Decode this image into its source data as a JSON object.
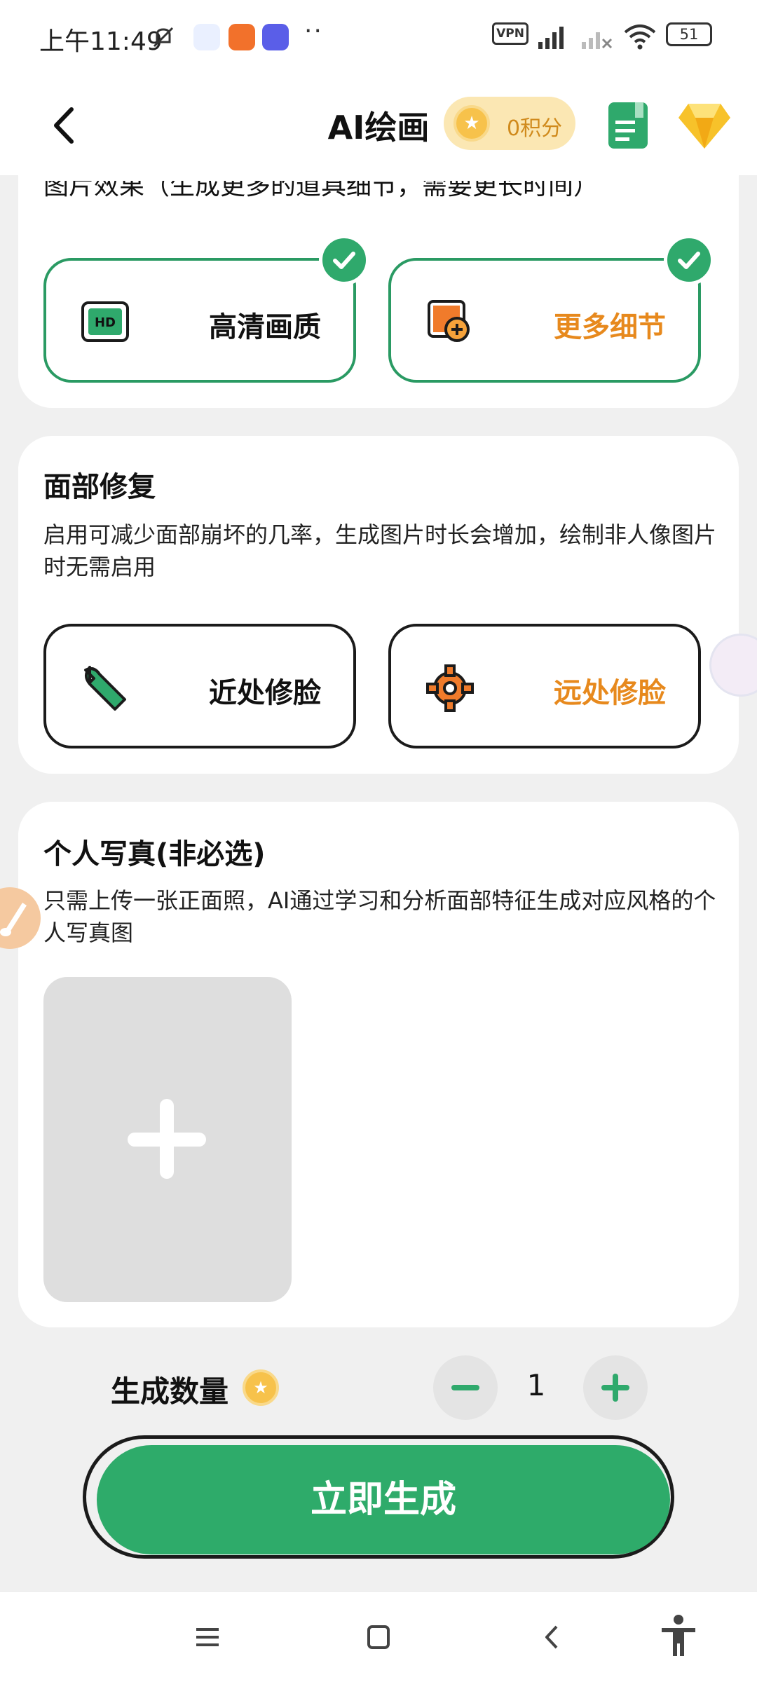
{
  "status_bar": {
    "time": "上午11:49",
    "vpn": "VPN",
    "battery": "51"
  },
  "header": {
    "title": "AI绘画",
    "points": "0积分"
  },
  "image_effect": {
    "title": "图片效果（生成更多的道具细节，需要更长时间）",
    "options": [
      {
        "label": "高清画质",
        "selected": true
      },
      {
        "label": "更多细节",
        "selected": true
      }
    ]
  },
  "face_repair": {
    "title": "面部修复",
    "description": "启用可减少面部崩坏的几率，生成图片时长会增加，绘制非人像图片时无需启用",
    "options": [
      {
        "label": "近处修脸"
      },
      {
        "label": "远处修脸"
      }
    ]
  },
  "portrait": {
    "title": "个人写真(非必选)",
    "description": "只需上传一张正面照，AI通过学习和分析面部特征生成对应风格的个人写真图"
  },
  "quantity": {
    "label": "生成数量",
    "value": "1"
  },
  "generate_button": "立即生成",
  "colors": {
    "accent_green": "#2eab6a",
    "accent_orange": "#e7891d",
    "coin_gold": "#f7c24b"
  }
}
